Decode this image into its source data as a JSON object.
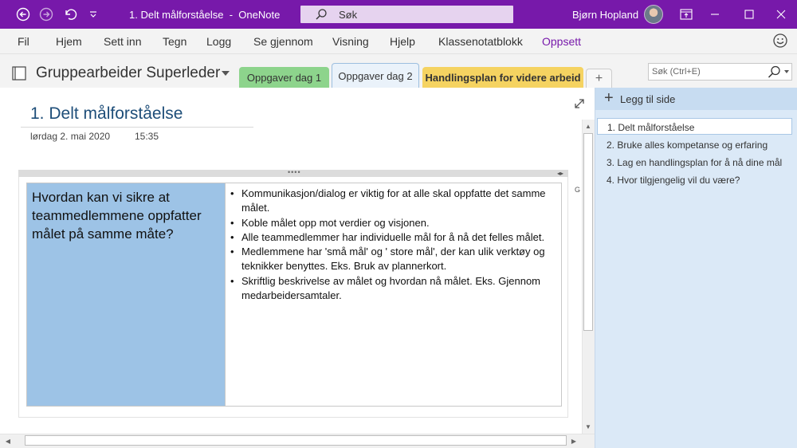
{
  "window": {
    "title": "1. Delt målforståelse",
    "app_name": "OneNote",
    "search_label": "Søk",
    "user_name": "Bjørn Hopland",
    "accent_color": "#7719aa"
  },
  "menu": {
    "items": [
      "Fil",
      "Hjem",
      "Sett inn",
      "Tegn",
      "Logg",
      "Se gjennom",
      "Visning",
      "Hjelp",
      "Klassenotatblokk",
      "Oppsett"
    ]
  },
  "notebook": {
    "name": "Gruppearbeider Superleder",
    "sections": [
      {
        "label": "Oppgaver dag 1",
        "color": "#8dd48c"
      },
      {
        "label": "Oppgaver dag 2",
        "color": "#eaf2fa"
      },
      {
        "label": "Handlingsplan for videre arbeid",
        "color": "#f5d361"
      }
    ],
    "add_section": "+",
    "search_placeholder": "Søk (Ctrl+E)"
  },
  "page": {
    "title": "1. Delt målforståelse",
    "date": "lørdag 2. mai 2020",
    "time": "15:35",
    "question": "Hvordan kan vi sikre at teammedlemmene oppfatter målet på samme måte?",
    "question_cell_color": "#9dc3e6",
    "answers": [
      "Kommunikasjon/dialog er viktig for at alle skal oppfatte det samme målet.",
      "Koble målet opp mot verdier og visjonen.",
      "Alle teammedlemmer har individuelle mål for å nå det felles målet.",
      "Medlemmene har 'små mål' og ' store mål',  der kan ulik verktøy og teknikker benyttes. Eks. Bruk av plannerkort.",
      "Skriftlig beskrivelse av målet og hvordan nå målet. Eks. Gjennom medarbeidersamtaler."
    ],
    "side_letter": "G"
  },
  "pages_pane": {
    "add_page_label": "Legg til side",
    "pages": [
      "1. Delt målforståelse",
      "2. Bruke alles kompetanse og erfaring",
      "3. Lag en handlingsplan for å nå dine mål",
      "4. Hvor tilgjengelig vil du være?"
    ]
  }
}
